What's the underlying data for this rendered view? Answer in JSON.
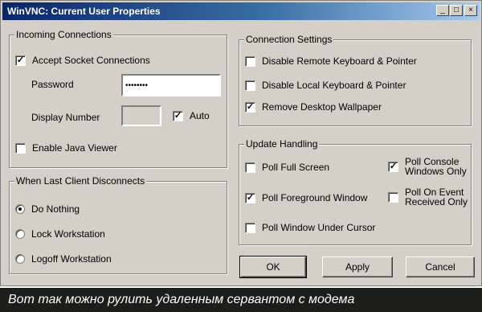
{
  "window": {
    "title": "WinVNC: Current User Properties",
    "controls": {
      "minimize": "_",
      "maximize": "□",
      "close": "×"
    }
  },
  "incoming": {
    "label": "Incoming Connections",
    "accept_socket": {
      "label": "Accept Socket Connections",
      "checked": true
    },
    "password": {
      "label": "Password",
      "value": "••••••••"
    },
    "display_number": {
      "label": "Display Number",
      "value": "",
      "auto_label": "Auto",
      "auto_checked": true
    },
    "java_viewer": {
      "label": "Enable Java Viewer",
      "checked": false
    }
  },
  "disconnect": {
    "label": "When Last Client Disconnects",
    "options": [
      {
        "label": "Do Nothing",
        "selected": true
      },
      {
        "label": "Lock Workstation",
        "selected": false
      },
      {
        "label": "Logoff Workstation",
        "selected": false
      }
    ]
  },
  "connection": {
    "label": "Connection Settings",
    "options": [
      {
        "label": "Disable Remote Keyboard & Pointer",
        "checked": false
      },
      {
        "label": "Disable Local Keyboard & Pointer",
        "checked": false
      },
      {
        "label": "Remove Desktop Wallpaper",
        "checked": true
      }
    ]
  },
  "update": {
    "label": "Update Handling",
    "poll_full_screen": {
      "label": "Poll Full Screen",
      "checked": false
    },
    "poll_foreground": {
      "label": "Poll Foreground Window",
      "checked": true
    },
    "poll_under_cursor": {
      "label": "Poll Window Under Cursor",
      "checked": false
    },
    "poll_console": {
      "label1": "Poll Console",
      "label2": "Windows Only",
      "checked": true
    },
    "poll_on_event": {
      "label1": "Poll On Event",
      "label2": "Received Only",
      "checked": false
    }
  },
  "buttons": {
    "ok": "OK",
    "apply": "Apply",
    "cancel": "Cancel"
  },
  "caption": "Вот так можно рулить удаленным сервантом с модема"
}
